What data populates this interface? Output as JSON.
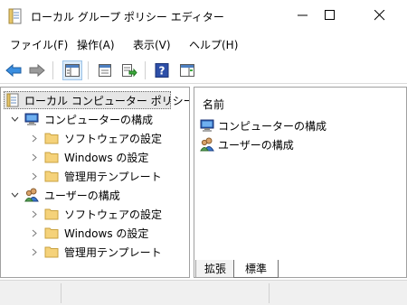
{
  "window": {
    "title": "ローカル グループ ポリシー エディター",
    "minimize_icon": "minimize-icon",
    "maximize_icon": "maximize-icon",
    "close_icon": "close-icon"
  },
  "menu": [
    {
      "label": "ファイル(F)"
    },
    {
      "label": "操作(A)"
    },
    {
      "label": "表示(V)"
    },
    {
      "label": "ヘルプ(H)"
    }
  ],
  "toolbar": {
    "buttons": [
      "back-arrow-icon",
      "forward-arrow-icon",
      "show-hide-tree-icon",
      "properties-icon",
      "export-list-icon",
      "help-icon",
      "show-hide-action-pane-icon"
    ]
  },
  "tree": {
    "root": "ローカル コンピューター ポリシー",
    "computer": {
      "label": "コンピューターの構成",
      "children": [
        "ソフトウェアの設定",
        "Windows の設定",
        "管理用テンプレート"
      ]
    },
    "user": {
      "label": "ユーザーの構成",
      "children": [
        "ソフトウェアの設定",
        "Windows の設定",
        "管理用テンプレート"
      ]
    }
  },
  "list": {
    "column_header": "名前",
    "items": [
      {
        "label": "コンピューターの構成",
        "icon": "computer-icon"
      },
      {
        "label": "ユーザーの構成",
        "icon": "users-icon"
      }
    ]
  },
  "tabs": {
    "extended": "拡張",
    "standard": "標準"
  },
  "colors": {
    "accent": "#1a73c8",
    "folder": "#f5d27a",
    "selected_bg": "#e6e6e6"
  }
}
